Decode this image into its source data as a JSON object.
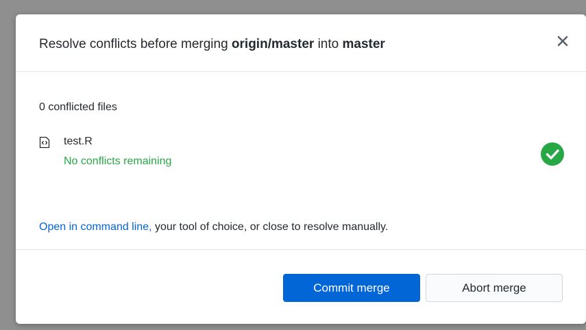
{
  "dialog": {
    "title_prefix": "Resolve conflicts before merging ",
    "source_branch": "origin/master",
    "title_middle": " into ",
    "target_branch": "master",
    "close_icon": "close-icon"
  },
  "body": {
    "conflict_count": "0 conflicted files",
    "files": [
      {
        "icon": "code-file-icon",
        "name": "test.R",
        "status": "No conflicts remaining",
        "status_icon": "check-circle-icon"
      }
    ],
    "hint_link": "Open in command line,",
    "hint_text": " your tool of choice, or close to resolve manually."
  },
  "footer": {
    "commit_label": "Commit merge",
    "abort_label": "Abort merge"
  },
  "colors": {
    "accent": "#0366d6",
    "success": "#28a745",
    "overlay": "#8f8f8f"
  }
}
